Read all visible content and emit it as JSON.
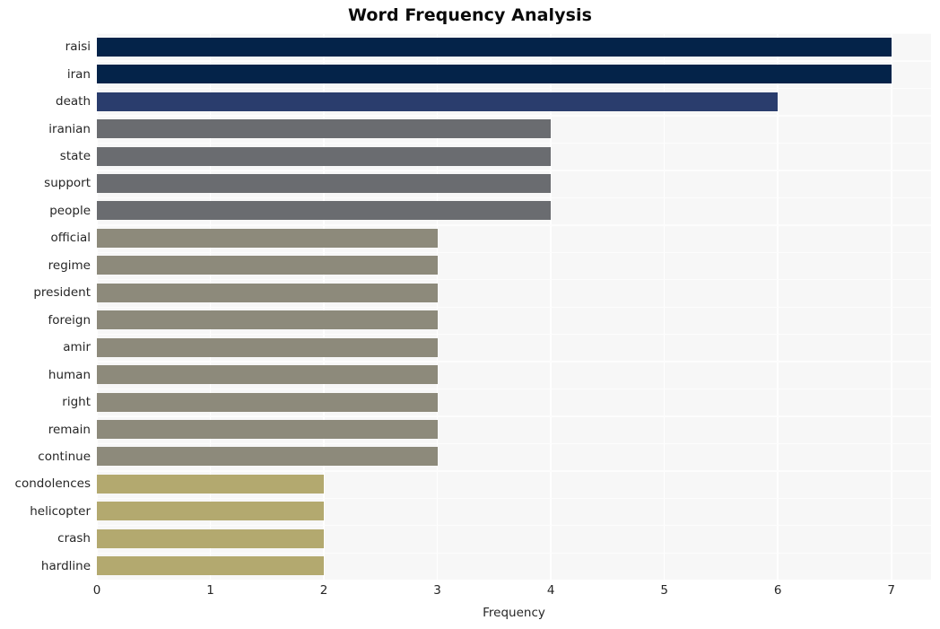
{
  "chart_data": {
    "type": "bar",
    "orientation": "horizontal",
    "title": "Word Frequency Analysis",
    "xlabel": "Frequency",
    "ylabel": "",
    "xlim": [
      0,
      7.35
    ],
    "xticks": [
      0,
      1,
      2,
      3,
      4,
      5,
      6,
      7
    ],
    "xtick_labels": [
      "0",
      "1",
      "2",
      "3",
      "4",
      "5",
      "6",
      "7"
    ],
    "grid": true,
    "legend": null,
    "plot_background": "#f7f7f7",
    "figure_background": "#ffffff",
    "gridline_color": "#ffffff",
    "categories": [
      "raisi",
      "iran",
      "death",
      "iranian",
      "state",
      "support",
      "people",
      "official",
      "regime",
      "president",
      "foreign",
      "amir",
      "human",
      "right",
      "remain",
      "continue",
      "condolences",
      "helicopter",
      "crash",
      "hardline"
    ],
    "values": [
      7,
      7,
      6,
      4,
      4,
      4,
      4,
      3,
      3,
      3,
      3,
      3,
      3,
      3,
      3,
      3,
      2,
      2,
      2,
      2
    ],
    "bar_colors": [
      "#042349",
      "#042349",
      "#2a3d6d",
      "#6a6c70",
      "#6a6c70",
      "#6a6c70",
      "#6a6c70",
      "#8d8a7b",
      "#8d8a7b",
      "#8d8a7b",
      "#8d8a7b",
      "#8d8a7b",
      "#8d8a7b",
      "#8d8a7b",
      "#8d8a7b",
      "#8d8a7b",
      "#b3a96f",
      "#b3a96f",
      "#b3a96f",
      "#b3a96f"
    ]
  }
}
